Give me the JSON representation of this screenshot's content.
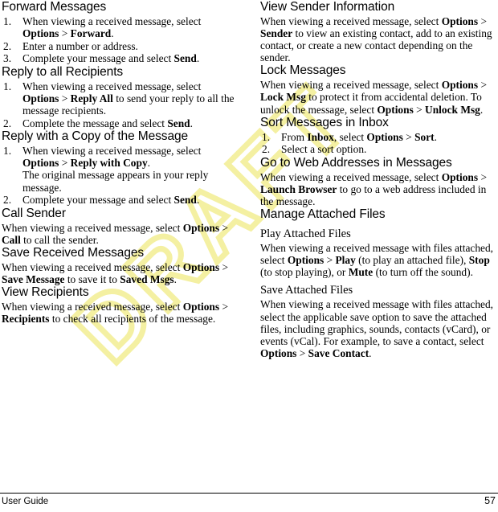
{
  "watermark": {
    "text": "DRAFT",
    "color": "#f4f0a2"
  },
  "footer": {
    "left_label": "User Guide",
    "page_number": "57",
    "rule_color": "#000000"
  },
  "left_column": {
    "sections": [
      {
        "heading": "Forward Messages",
        "steps": [
          {
            "lead": "When viewing a received message, select ",
            "bold1": "Options",
            "mid": " > ",
            "bold2": "Forward",
            "tail": "."
          },
          {
            "lead": "Enter a number or address.",
            "bold1": "",
            "mid": "",
            "bold2": "",
            "tail": ""
          },
          {
            "lead": "Complete your message and select ",
            "bold1": "Send",
            "mid": "",
            "bold2": "",
            "tail": "."
          }
        ]
      },
      {
        "heading": "Reply to all Recipients",
        "steps": [
          {
            "lead": "When viewing a received message, select ",
            "bold1": "Options",
            "mid": " > ",
            "bold2": "Reply All",
            "tail": " to send your reply to all the message recipients."
          },
          {
            "lead": "Complete the message and select ",
            "bold1": "Send",
            "mid": "",
            "bold2": "",
            "tail": "."
          }
        ]
      },
      {
        "heading": "Reply with a Copy of the Message",
        "steps": [
          {
            "lead": "When viewing a received message, select ",
            "bold1": "Options",
            "mid": " > ",
            "bold2": "Reply with Copy",
            "tail": ".",
            "continuation": "The original message appears in your reply message."
          },
          {
            "lead": "Complete your message and select ",
            "bold1": "Send",
            "mid": "",
            "bold2": "",
            "tail": "."
          }
        ]
      },
      {
        "heading": "Call Sender",
        "paragraph": {
          "lead": "When viewing a received message, select ",
          "bold1": "Options",
          "mid": " > ",
          "bold2": "Call",
          "tail": " to call the sender."
        }
      },
      {
        "heading": "Save Received Messages",
        "paragraph": {
          "lead": "When viewing a received message, select ",
          "bold1": "Options",
          "mid": " > ",
          "bold2": "Save Message",
          "tail": " to save it to ",
          "bold3": "Saved Msgs",
          "tail2": "."
        }
      },
      {
        "heading": "View Recipients",
        "paragraph": {
          "lead": "When viewing a received message, select ",
          "bold1": "Options",
          "mid": " > ",
          "bold2": "Recipients",
          "tail": " to check all recipients of the message."
        }
      }
    ]
  },
  "right_column": {
    "sections": [
      {
        "heading": "View Sender Information",
        "paragraph": {
          "lead": "When viewing a received message, select ",
          "bold1": "Options",
          "mid": " > ",
          "bold2": "Sender",
          "tail": " to view an existing contact, add to an existing contact, or create a new contact depending on the sender."
        }
      },
      {
        "heading": "Lock Messages",
        "paragraph": {
          "lead": "When viewing a received message, select ",
          "bold1": "Options",
          "mid": " > ",
          "bold2": "Lock Msg",
          "tail": " to protect it from accidental deletion. To unlock the message, select ",
          "bold3": "Options",
          "mid2": " > ",
          "bold4": "Unlock Msg",
          "tail2": "."
        }
      },
      {
        "heading": "Sort Messages in Inbox",
        "steps": [
          {
            "lead": "From ",
            "bold1": "Inbox",
            "mid": ", select ",
            "bold2": "Options",
            "mid2": " > ",
            "bold3": "Sort",
            "tail": "."
          },
          {
            "lead": "Select a sort option.",
            "bold1": "",
            "mid": "",
            "bold2": "",
            "tail": ""
          }
        ]
      },
      {
        "heading": "Go to Web Addresses in Messages",
        "paragraph": {
          "lead": "When viewing a received message, select ",
          "bold1": "Options",
          "mid": " > ",
          "bold2": "Launch Browser",
          "tail": " to go to a web address included in the message."
        }
      },
      {
        "heading": "Manage Attached Files",
        "subsections": [
          {
            "subheading": "Play Attached Files",
            "paragraph": {
              "lead": "When viewing a received message with files attached, select ",
              "bold1": "Options",
              "mid": " > ",
              "bold2": "Play",
              "tail": " (to play an attached file), ",
              "bold3": "Stop",
              "tail2": " (to stop playing), or ",
              "bold4": "Mute",
              "tail3": " (to turn off the sound)."
            }
          },
          {
            "subheading": "Save Attached Files",
            "paragraph": {
              "lead": "When viewing a received message with files attached, select the applicable save option to save the attached files, including graphics, sounds, contacts (vCard), or events (vCal). For example, to save a contact, select ",
              "bold1": "Options",
              "mid": " > ",
              "bold2": "Save Contact",
              "tail": "."
            }
          }
        ]
      }
    ]
  }
}
